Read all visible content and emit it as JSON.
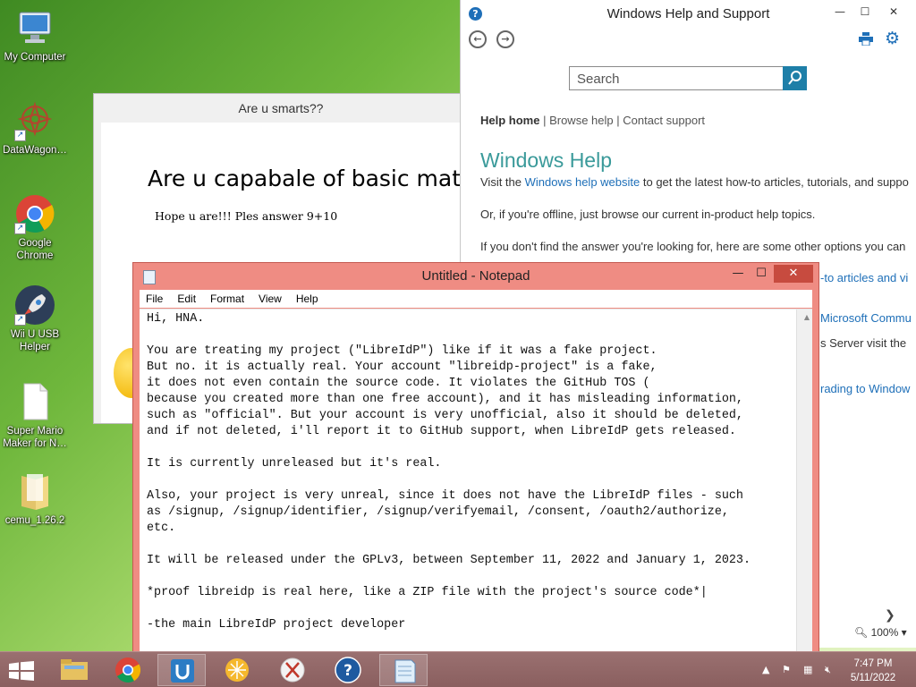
{
  "desktop": {
    "icons": [
      {
        "label": "My Computer",
        "icon": "computer-icon"
      },
      {
        "label": "DataWagon…",
        "icon": "datawagon-icon"
      },
      {
        "label": "Google Chrome",
        "icon": "chrome-icon"
      },
      {
        "label": "Wii U USB Helper",
        "icon": "rocket-icon"
      },
      {
        "label": "Super Mario Maker for N…",
        "icon": "file-icon"
      },
      {
        "label": "cemu_1.26.2",
        "icon": "folder-icon"
      }
    ]
  },
  "quiz_window": {
    "title": "Are u smarts??",
    "heading": "Are u capabale of basic mat",
    "text": "Hope u are!!! Ples answer 9+10"
  },
  "help_window": {
    "title": "Windows Help and Support",
    "search_placeholder": "Search",
    "links": {
      "home": "Help home",
      "browse": "Browse help",
      "contact": "Contact support"
    },
    "heading": "Windows Help",
    "para1_prefix": "Visit the ",
    "para1_link": "Windows help website",
    "para1_suffix": " to get the latest how-to articles, tutorials, and suppo",
    "para2": "Or, if you're offline, just browse our current in-product help topics.",
    "para3": "If you don't find the answer you're looking for, here are some other options you can",
    "frag1": "-to articles and vi",
    "frag2": "Microsoft Commu",
    "frag3": "s Server visit the",
    "frag4": "rading to Window",
    "zoom": "100%"
  },
  "notepad": {
    "title": "Untitled - Notepad",
    "menu": [
      "File",
      "Edit",
      "Format",
      "View",
      "Help"
    ],
    "content": "Hi, HNA.\n\nYou are treating my project (\"LibreIdP\") like if it was a fake project.\nBut no. it is actually real. Your account \"libreidp-project\" is a fake,\nit does not even contain the source code. It violates the GitHub TOS (\nbecause you created more than one free account), and it has misleading information,\nsuch as \"official\". But your account is very unofficial, also it should be deleted,\nand if not deleted, i'll report it to GitHub support, when LibreIdP gets released.\n\nIt is currently unreleased but it's real.\n\nAlso, your project is very unreal, since it does not have the LibreIdP files - such\nas /signup, /signup/identifier, /signup/verifyemail, /consent, /oauth2/authorize,\netc.\n\nIt will be released under the GPLv3, between September 11, 2022 and January 1, 2023.\n\n*proof libreidp is real here, like a ZIP file with the project's source code*|\n\n-the main LibreIdP project developer"
  },
  "taskbar": {
    "apps": [
      "file-explorer-icon",
      "chrome-icon",
      "wii-u-usb-helper-icon",
      "citra-icon",
      "snipping-tool-icon",
      "help-icon",
      "notepad-icon"
    ],
    "time": "7:47 PM",
    "date": "5/11/2022"
  }
}
